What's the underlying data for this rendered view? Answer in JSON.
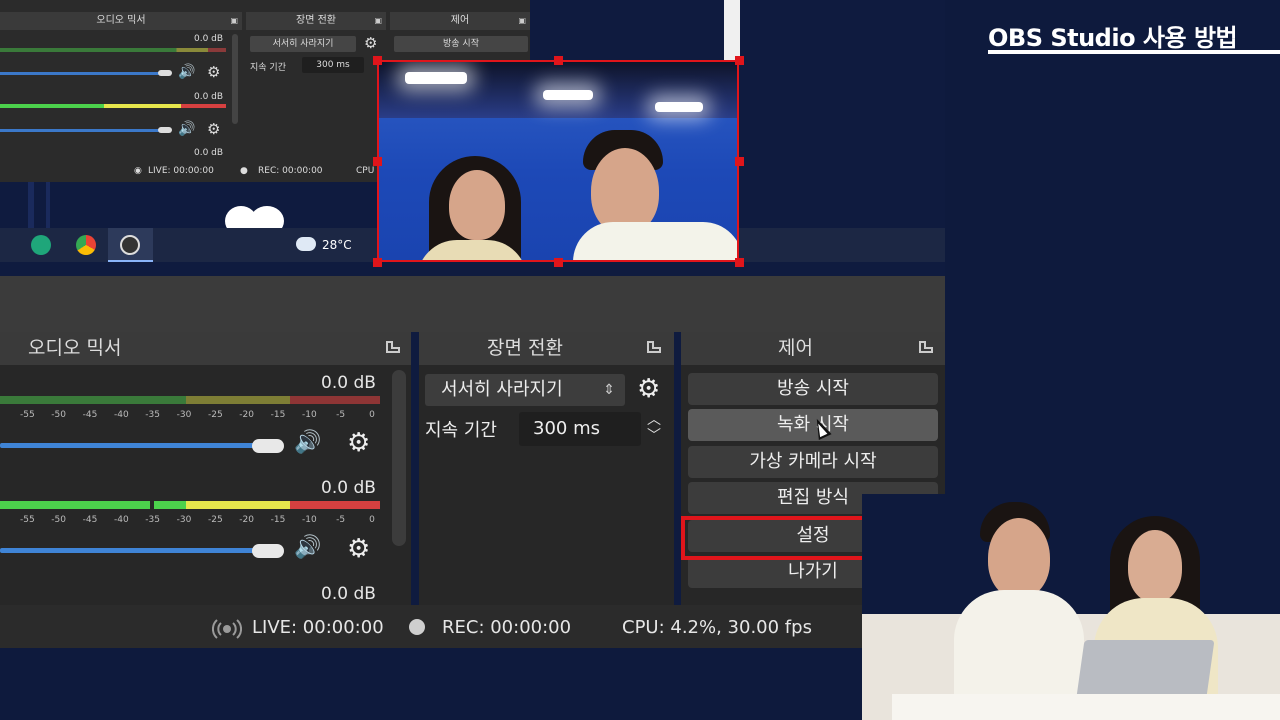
{
  "video": {
    "title": "OBS Studio 사용 방법"
  },
  "mini_obs": {
    "audio_title": "오디오 믹서",
    "transition_title": "장면 전환",
    "controls_title": "제어",
    "db_values": [
      "0.0 dB",
      "0.0 dB",
      "0.0 dB"
    ],
    "transition_value": "서서히 사라지기",
    "duration_label": "지속 기간",
    "duration_value": "300 ms",
    "stream_button": "방송 시작",
    "live": "LIVE: 00:00:00",
    "rec": "REC: 00:00:00",
    "cpu": "CPU"
  },
  "taskbar": {
    "weather": "28°C"
  },
  "audio_mixer": {
    "title": "오디오 믹서",
    "channels": [
      {
        "db_top": "0.0 dB",
        "ticks": [
          "-55",
          "-50",
          "-45",
          "-40",
          "-35",
          "-30",
          "-25",
          "-20",
          "-15",
          "-10",
          "-5",
          "0"
        ]
      },
      {
        "db_top": "0.0 dB",
        "ticks": [
          "-55",
          "-50",
          "-45",
          "-40",
          "-35",
          "-30",
          "-25",
          "-20",
          "-15",
          "-10",
          "-5",
          "0"
        ]
      }
    ],
    "db_bottom": "0.0 dB"
  },
  "scene_transitions": {
    "title": "장면 전환",
    "selected": "서서히 사라지기",
    "duration_label": "지속 기간",
    "duration_value": "300 ms"
  },
  "controls": {
    "title": "제어",
    "buttons": [
      "방송 시작",
      "녹화 시작",
      "가상 카메라 시작",
      "편집 방식",
      "설정",
      "나가기"
    ]
  },
  "status": {
    "live": "LIVE: 00:00:00",
    "rec": "REC: 00:00:00",
    "cpu": "CPU: 4.2%, 30.00 fps"
  },
  "colors": {
    "highlight": "#e0151b",
    "meter_green": "#4cd14c",
    "meter_yellow": "#e6e64c",
    "meter_red": "#d64040",
    "volume": "#3f84d6"
  }
}
